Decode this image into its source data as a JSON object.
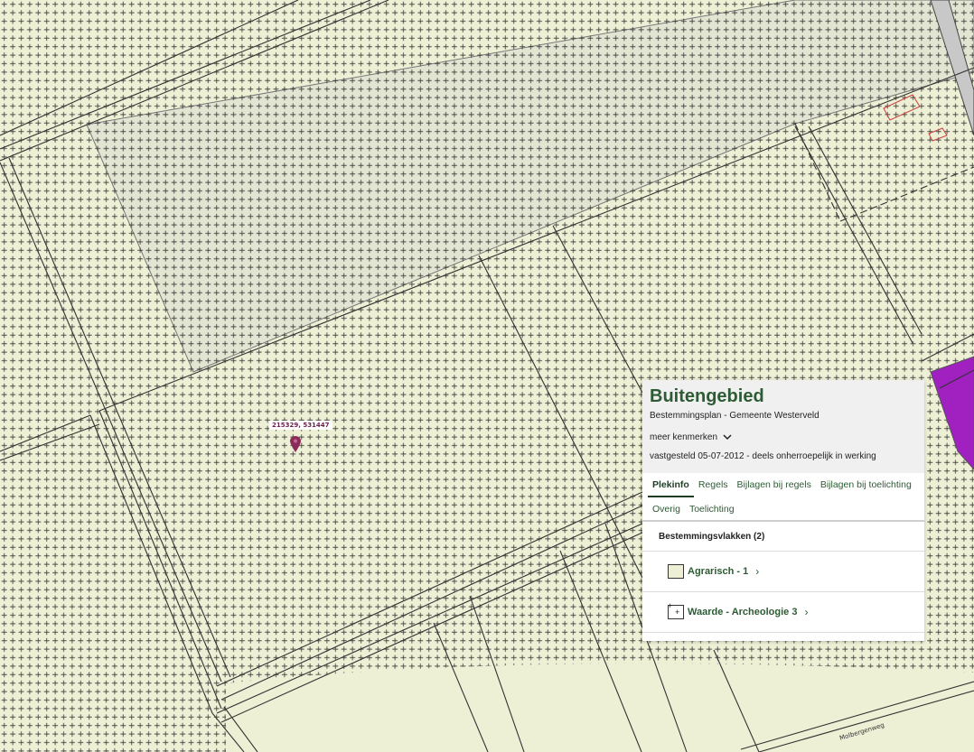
{
  "map": {
    "coordinate_label": "215329, 531447",
    "street_label": "Molbergenweg",
    "colors": {
      "agrarisch": "#eef0d6",
      "bos": "#e2e5d2",
      "road": "#c8c8c8",
      "purple": "#a020c0",
      "pin": "#8b2b5a"
    }
  },
  "panel": {
    "title": "Buitengebied",
    "subtitle": "Bestemmingsplan - Gemeente Westerveld",
    "more_features": "meer kenmerken",
    "status": "vastgesteld 05-07-2012 - deels onherroepelijk in werking",
    "tabs": [
      {
        "label": "Plekinfo",
        "active": true
      },
      {
        "label": "Regels"
      },
      {
        "label": "Bijlagen bij regels"
      },
      {
        "label": "Bijlagen bij toelichting"
      },
      {
        "label": "Overig"
      },
      {
        "label": "Toelichting"
      }
    ],
    "section_title": "Bestemmingsvlakken (2)",
    "items": [
      {
        "label": "Agrarisch - 1"
      },
      {
        "label": "Waarde - Archeologie 3"
      }
    ]
  }
}
